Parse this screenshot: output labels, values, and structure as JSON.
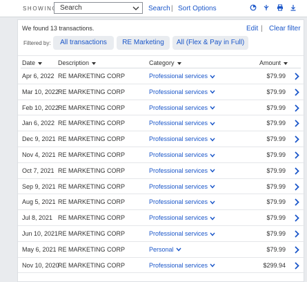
{
  "topbar": {
    "showing_label": "SHOWING",
    "search_value": "Search",
    "search_link": "Search",
    "separator": "|",
    "sort_link": "Sort Options",
    "icons": [
      "chart-icon",
      "split-icon",
      "print-icon",
      "download-icon"
    ]
  },
  "summary": {
    "found_text": "We found 13 transactions.",
    "edit": "Edit",
    "separator": "|",
    "clear_filter": "Clear filter"
  },
  "filters": {
    "label": "Filtered by:",
    "chips": [
      "All transactions",
      "RE Marketing",
      "All (Flex & Pay in Full)"
    ]
  },
  "table": {
    "headers": {
      "date": "Date",
      "description": "Description",
      "category": "Category",
      "amount": "Amount"
    },
    "rows": [
      {
        "date": "Apr 6, 2022",
        "description": "RE MARKETING CORP",
        "category": "Professional services",
        "amount": "$79.99"
      },
      {
        "date": "Mar 10, 2022",
        "description": "RE MARKETING CORP",
        "category": "Professional services",
        "amount": "$79.99"
      },
      {
        "date": "Feb 10, 2022",
        "description": "RE MARKETING CORP",
        "category": "Professional services",
        "amount": "$79.99"
      },
      {
        "date": "Jan 6, 2022",
        "description": "RE MARKETING CORP",
        "category": "Professional services",
        "amount": "$79.99"
      },
      {
        "date": "Dec 9, 2021",
        "description": "RE MARKETING CORP",
        "category": "Professional services",
        "amount": "$79.99"
      },
      {
        "date": "Nov 4, 2021",
        "description": "RE MARKETING CORP",
        "category": "Professional services",
        "amount": "$79.99"
      },
      {
        "date": "Oct 7, 2021",
        "description": "RE MARKETING CORP",
        "category": "Professional services",
        "amount": "$79.99"
      },
      {
        "date": "Sep 9, 2021",
        "description": "RE MARKETING CORP",
        "category": "Professional services",
        "amount": "$79.99"
      },
      {
        "date": "Aug 5, 2021",
        "description": "RE MARKETING CORP",
        "category": "Professional services",
        "amount": "$79.99"
      },
      {
        "date": "Jul 8, 2021",
        "description": "RE MARKETING CORP",
        "category": "Professional services",
        "amount": "$79.99"
      },
      {
        "date": "Jun 10, 2021",
        "description": "RE MARKETING CORP",
        "category": "Professional services",
        "amount": "$79.99"
      },
      {
        "date": "May 6, 2021",
        "description": "RE MARKETING CORP",
        "category": "Personal",
        "amount": "$79.99"
      },
      {
        "date": "Nov 10, 2020",
        "description": "RE MARKETING CORP",
        "category": "Professional services",
        "amount": "$299.94"
      }
    ]
  },
  "colors": {
    "link": "#1a56c9",
    "chip_bg": "#e9ecf0",
    "page_bg": "#e9ebee"
  }
}
